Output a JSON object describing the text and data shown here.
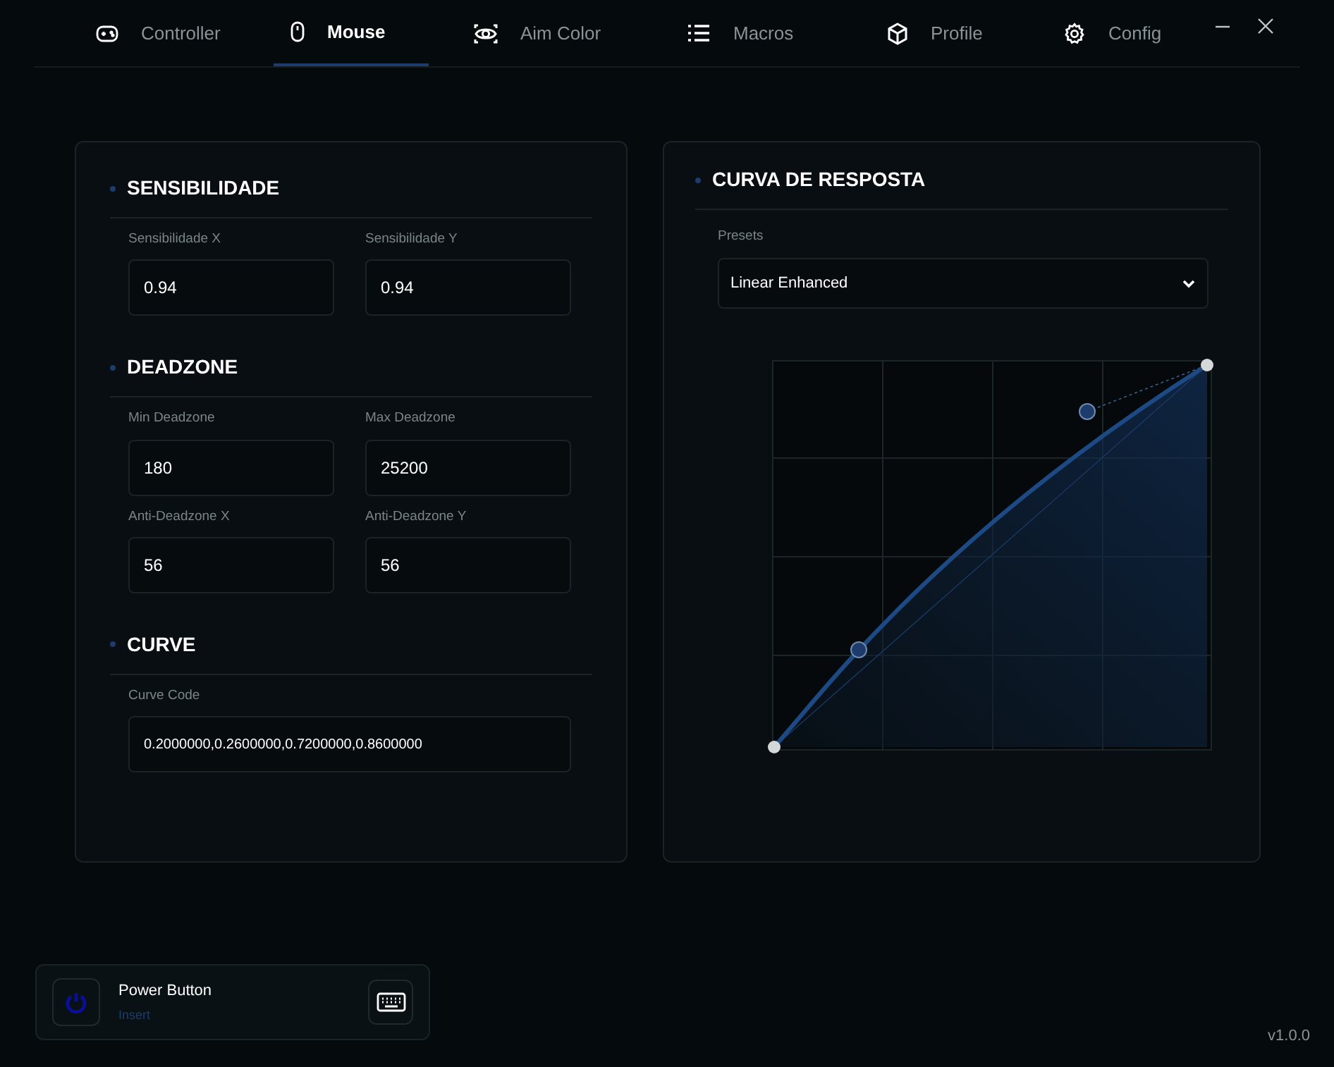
{
  "tabs": [
    {
      "label": "Controller",
      "selected": false
    },
    {
      "label": "Mouse",
      "selected": true
    },
    {
      "label": "Aim Color",
      "selected": false
    },
    {
      "label": "Macros",
      "selected": false
    },
    {
      "label": "Profile",
      "selected": false
    },
    {
      "label": "Config",
      "selected": false
    }
  ],
  "sections": [
    {
      "title": "SENSIBILIDADE",
      "fields": [
        {
          "label": "Sensibilidade X",
          "value": "0.94"
        },
        {
          "label": "Sensibilidade Y",
          "value": "0.94"
        }
      ]
    },
    {
      "title": "DEADZONE",
      "fields": [
        {
          "label": "Min Deadzone",
          "value": "180"
        },
        {
          "label": "Max Deadzone",
          "value": "25200"
        },
        {
          "label": "Anti-Deadzone X",
          "value": "56"
        },
        {
          "label": "Anti-Deadzone Y",
          "value": "56"
        }
      ]
    },
    {
      "title": "CURVE",
      "fields": [
        {
          "label": "Curve Code",
          "value": "0.2000000,0.2600000,0.7200000,0.8600000"
        }
      ]
    }
  ],
  "curve_panel": {
    "title": "CURVA DE RESPOSTA",
    "presets_label": "Presets",
    "preset": "Linear Enhanced"
  },
  "power_button": {
    "title": "Power Button",
    "key": "Insert"
  },
  "version": "v1.0.0"
}
